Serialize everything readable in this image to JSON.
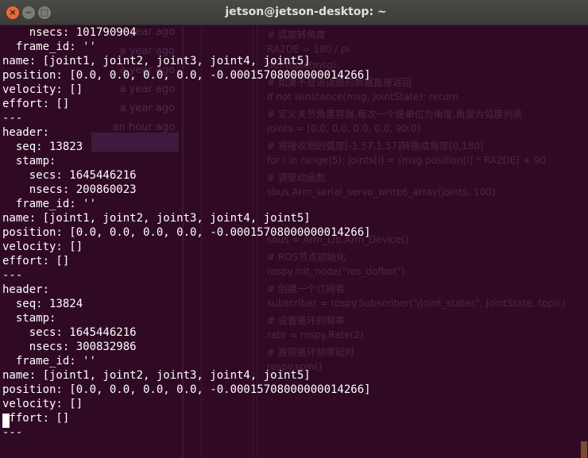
{
  "window": {
    "title": "jetson@jetson-desktop: ~",
    "close_glyph": "×",
    "minimize_glyph": "−",
    "maximize_glyph": "□"
  },
  "terminal": {
    "lines": [
      "    nsecs: 101790904",
      "  frame_id: ''",
      "name: [joint1, joint2, joint3, joint4, joint5]",
      "position: [0.0, 0.0, 0.0, 0.0, -0.00015708000000014266]",
      "velocity: []",
      "effort: []",
      "---",
      "header:",
      "  seq: 13823",
      "  stamp:",
      "    secs: 1645446216",
      "    nsecs: 200860023",
      "  frame_id: ''",
      "name: [joint1, joint2, joint3, joint4, joint5]",
      "position: [0.0, 0.0, 0.0, 0.0, -0.00015708000000014266]",
      "velocity: []",
      "effort: []",
      "---",
      "header:",
      "  seq: 13824",
      "  stamp:",
      "    secs: 1645446216",
      "    nsecs: 300832986",
      "  frame_id: ''",
      "name: [joint1, joint2, joint3, joint4, joint5]",
      "position: [0.0, 0.0, 0.0, 0.0, -0.00015708000000014266]",
      "velocity: []",
      "effort: []",
      "---"
    ]
  },
  "background": {
    "times": [
      "a year ago",
      "a year ago",
      "a year ago",
      "a year ago",
      "a year ago",
      "an hour ago"
    ],
    "code_lines": [
      "# 弧度转角度",
      "RA2DE = 180 / pi",
      "def topic(msg):",
      "    # 如果不是该话题的数据直接返回",
      "    if not isinstance(msg, JointState): return",
      "    # 定义关节角度容器,每次一个是单位为角度,角度为弧度列表",
      "    joints = [0.0, 0.0, 0.0, 0.0, 90.0]",
      "    # 将接收到的弧度[-1.57,1.57]转换成角度[0,180]",
      "    for i in range(5): joints[i] = (msg.position[i] * RA2DE) + 90",
      "    # 调驱动函数",
      "    sbus.Arm_serial_servo_write6_array(joints, 100)",
      "",
      "",
      "    sbus = Arm_Lib.Arm_Device()",
      "    # ROS节点初始化",
      "    rospy.init_node(\"ros_dofbot\")",
      "    # 创建一个订阅者",
      "    subscriber = rospy.Subscriber(\"/joint_states\", JointState, topic)",
      "    # 设置循环的频率",
      "    rate = rospy.Rate(2)",
      "    # 按照循环频率延时",
      "    rospy.spin()"
    ]
  },
  "colors": {
    "terminal_bg": "#300a24",
    "terminal_fg": "#ffffff",
    "close_button": "#e56b3c",
    "titlebar": "#3c3b37"
  },
  "icons": [
    "close-icon",
    "minimize-icon",
    "maximize-icon"
  ]
}
